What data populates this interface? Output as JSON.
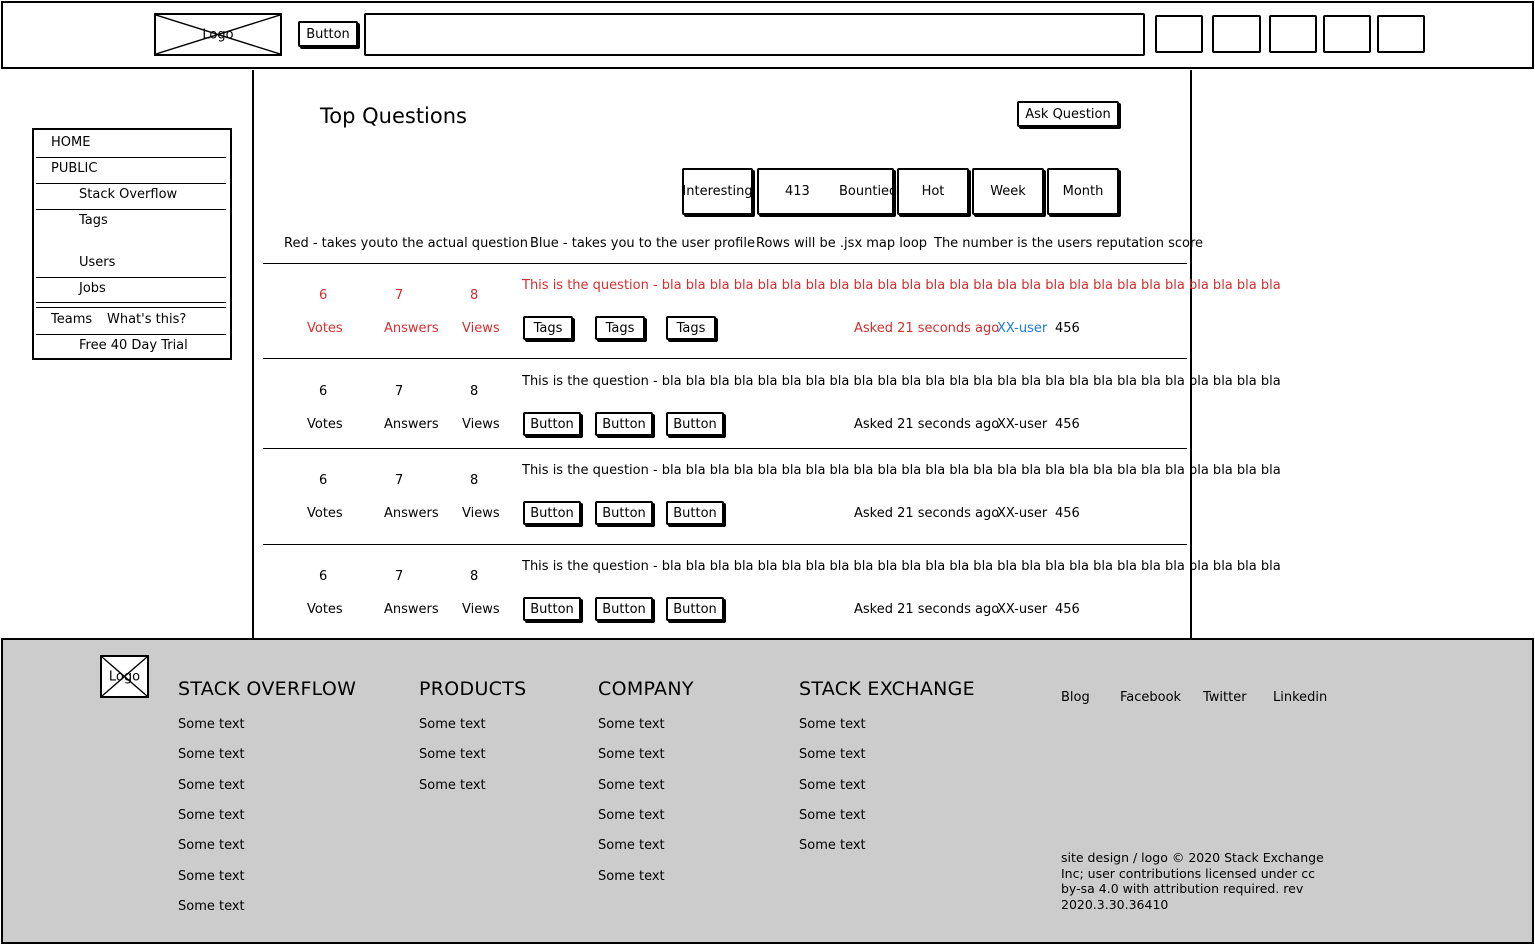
{
  "header": {
    "logo_label": "Logo",
    "button_label": "Button",
    "search_placeholder": ""
  },
  "sidebar": {
    "items": [
      {
        "label": "HOME"
      },
      {
        "label": "PUBLIC"
      },
      {
        "label": "Stack Overflow"
      },
      {
        "label": "Tags"
      },
      {
        "label": "Users"
      },
      {
        "label": "Jobs"
      },
      {
        "label": "Teams"
      },
      {
        "label": "What's this?"
      },
      {
        "label": "Free 40 Day Trial"
      }
    ]
  },
  "main": {
    "title": "Top Questions",
    "ask_button": "Ask Question",
    "filters": [
      "Interesting",
      "413",
      "Bountied",
      "Hot",
      "Week",
      "Month"
    ],
    "notes": [
      "Red - takes you",
      "to the actual question",
      "Blue - takes you to the user profile",
      "Rows will be .jsx map loop",
      "The number is the users reputation score"
    ],
    "questions": [
      {
        "votes": "6",
        "answers": "7",
        "views": "8",
        "votes_label": "Votes",
        "answers_label": "Answers",
        "views_label": "Views",
        "title": "This is the question - bla  bla bla bla bla bla bla bla bla bla bla bla bla bla bla bla bla bla bla bla bla bla bla bla bla bla",
        "tags": [
          "Tags",
          "Tags",
          "Tags"
        ],
        "asked": "Asked 21 seconds ago",
        "user": "XX-user",
        "rep": "456"
      },
      {
        "votes": "6",
        "answers": "7",
        "views": "8",
        "votes_label": "Votes",
        "answers_label": "Answers",
        "views_label": "Views",
        "title": "This is the question - bla  bla bla bla bla bla bla bla bla bla bla bla bla bla bla bla bla bla bla bla bla bla bla bla bla bla",
        "tags": [
          "Button",
          "Button",
          "Button"
        ],
        "asked": "Asked 21 seconds ago",
        "user": "XX-user",
        "rep": "456"
      },
      {
        "votes": "6",
        "answers": "7",
        "views": "8",
        "votes_label": "Votes",
        "answers_label": "Answers",
        "views_label": "Views",
        "title": "This is the question - bla  bla bla bla bla bla bla bla bla bla bla bla bla bla bla bla bla bla bla bla bla bla bla bla bla bla",
        "tags": [
          "Button",
          "Button",
          "Button"
        ],
        "asked": "Asked 21 seconds ago",
        "user": "XX-user",
        "rep": "456"
      },
      {
        "votes": "6",
        "answers": "7",
        "views": "8",
        "votes_label": "Votes",
        "answers_label": "Answers",
        "views_label": "Views",
        "title": "This is the question - bla  bla bla bla bla bla bla bla bla bla bla bla bla bla bla bla bla bla bla bla bla bla bla bla bla bla",
        "tags": [
          "Button",
          "Button",
          "Button"
        ],
        "asked": "Asked 21 seconds ago",
        "user": "XX-user",
        "rep": "456"
      }
    ]
  },
  "footer": {
    "logo_label": "Logo",
    "columns": [
      {
        "heading": "STACK OVERFLOW",
        "items": [
          "Some text",
          "Some text",
          "Some text",
          "Some text",
          "Some text",
          "Some text",
          "Some text"
        ]
      },
      {
        "heading": "PRODUCTS",
        "items": [
          "Some text",
          "Some text",
          "Some text"
        ]
      },
      {
        "heading": "COMPANY",
        "items": [
          "Some text",
          "Some text",
          "Some text",
          "Some text",
          "Some text",
          "Some text"
        ]
      },
      {
        "heading": "STACK EXCHANGE",
        "items": [
          "Some text",
          "Some text",
          "Some text",
          "Some text",
          "Some text"
        ]
      }
    ],
    "social": [
      "Blog",
      "Facebook",
      "Twitter",
      "Linkedin"
    ],
    "legal": "site design / logo © 2020 Stack Exchange Inc; user contributions licensed under cc by-sa 4.0 with attribution required. rev 2020.3.30.36410"
  },
  "colors": {
    "question_link": "#d32f2f",
    "user_link": "#1e7be0",
    "footer_bg": "#cccccc"
  }
}
